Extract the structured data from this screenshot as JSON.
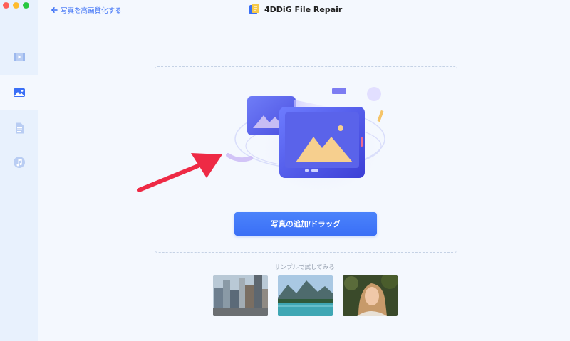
{
  "window": {
    "traffic_lights": [
      "close",
      "minimize",
      "zoom"
    ]
  },
  "header": {
    "back_label": "写真を高画質化する",
    "app_title": "4DDiG File Repair"
  },
  "sidebar": {
    "items": [
      {
        "icon": "video-icon",
        "active": false
      },
      {
        "icon": "photo-icon",
        "active": true
      },
      {
        "icon": "document-icon",
        "active": false
      },
      {
        "icon": "music-icon",
        "active": false
      }
    ]
  },
  "main": {
    "add_button_label": "写真の追加/ドラッグ",
    "sample_label": "サンプルで試してみる",
    "samples": [
      {
        "icon": "city-buildings-sample"
      },
      {
        "icon": "mountain-lake-sample"
      },
      {
        "icon": "portrait-woman-sample"
      }
    ]
  },
  "colors": {
    "accent": "#3a6ff6",
    "annotation_arrow": "#ee2a45",
    "sidebar_bg": "#e8f1fd",
    "page_bg": "#f4f8fe"
  }
}
